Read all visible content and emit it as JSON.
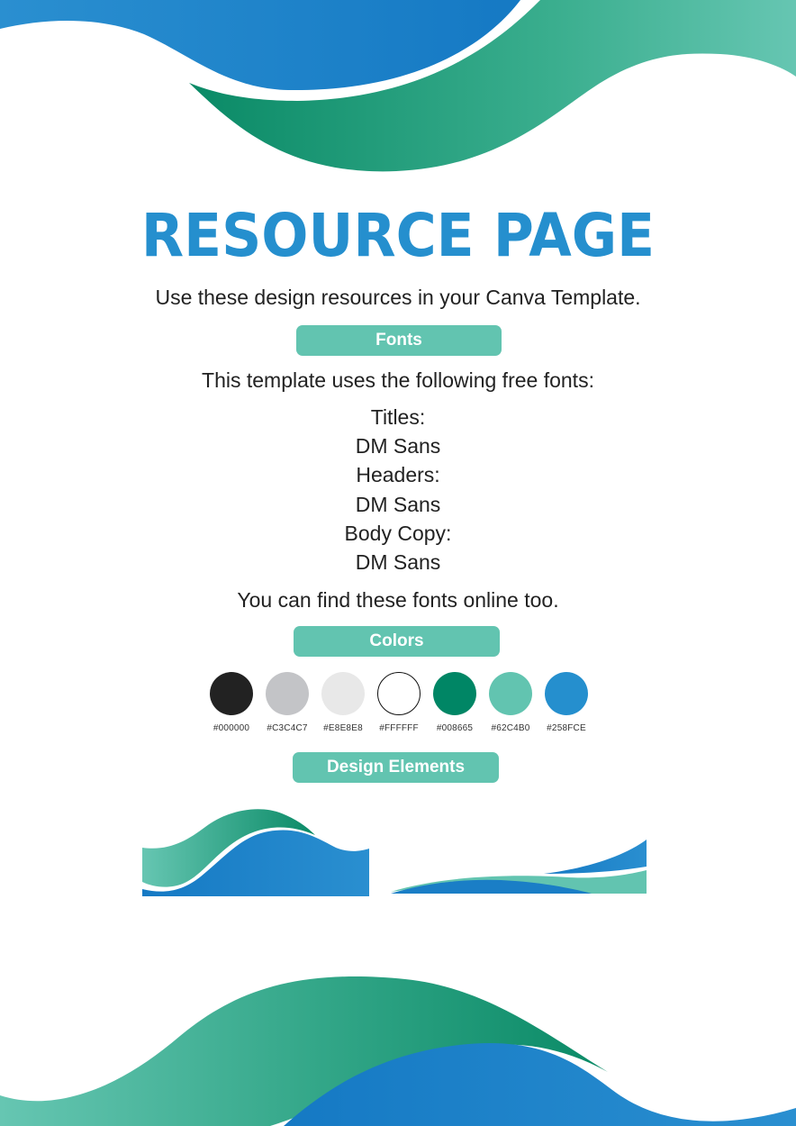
{
  "page": {
    "title": "RESOURCE PAGE",
    "subtitle": "Use these design resources in your Canva Template."
  },
  "fonts_section": {
    "label": "Fonts",
    "intro": "This template uses the following free fonts:",
    "entries": [
      {
        "role": "Titles:",
        "font": "DM Sans"
      },
      {
        "role": "Headers:",
        "font": "DM Sans"
      },
      {
        "role": "Body Copy:",
        "font": "DM Sans"
      }
    ],
    "outro": "You can find these fonts online too."
  },
  "colors_section": {
    "label": "Colors",
    "swatches": [
      {
        "hex": "#000000",
        "color": "#222222",
        "outlined": false
      },
      {
        "hex": "#C3C4C7",
        "color": "#C3C4C7",
        "outlined": false
      },
      {
        "hex": "#E8E8E8",
        "color": "#E8E8E8",
        "outlined": false
      },
      {
        "hex": "#FFFFFF",
        "color": "#FFFFFF",
        "outlined": true
      },
      {
        "hex": "#008665",
        "color": "#008665",
        "outlined": false
      },
      {
        "hex": "#62C4B0",
        "color": "#62C4B0",
        "outlined": false
      },
      {
        "hex": "#258FCE",
        "color": "#258FCE",
        "outlined": false
      }
    ]
  },
  "design_section": {
    "label": "Design Elements"
  },
  "theme": {
    "blue": "#258FCE",
    "blue_dark": "#1579C0",
    "green": "#008665",
    "teal": "#62C4B0",
    "pill": "#62C4B0"
  }
}
